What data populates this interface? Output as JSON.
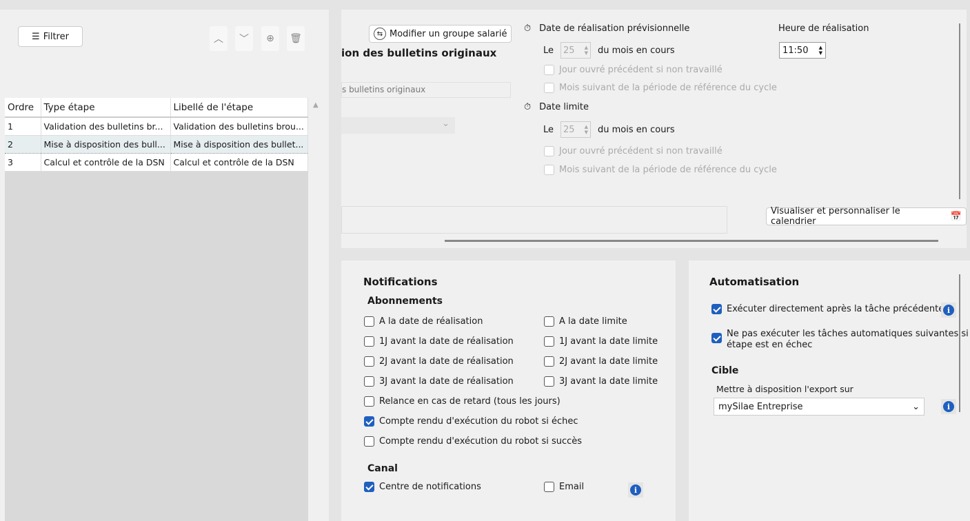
{
  "left": {
    "filter_label": "Filtrer",
    "columns": [
      "Ordre",
      "Type étape",
      "Libellé de l'étape"
    ],
    "rows": [
      {
        "ordre": "1",
        "type": "Validation des bulletins br...",
        "libelle": "Validation des bulletins brou..."
      },
      {
        "ordre": "2",
        "type": "Mise à disposition des bull...",
        "libelle": "Mise à disposition des bullet..."
      },
      {
        "ordre": "3",
        "type": "Calcul et contrôle de la DSN",
        "libelle": "Calcul et contrôle de la DSN"
      }
    ]
  },
  "step": {
    "modify_group_label": "Modifier un groupe salarié",
    "title": "ion des bulletins originaux",
    "name_value": "s bulletins originaux"
  },
  "schedule": {
    "planned_label": "Date de réalisation prévisionnelle",
    "le": "Le",
    "planned_day": "25",
    "month_label": "du mois en cours",
    "prev_workday": "Jour ouvré précédent si non travaillé",
    "next_month": "Mois suivant de la période de référence du cycle",
    "deadline_label": "Date limite",
    "deadline_day": "25",
    "time_label": "Heure de réalisation",
    "time_value": "11:50",
    "calendar_button": "Visualiser et personnaliser le calendrier"
  },
  "notifications": {
    "title": "Notifications",
    "subs_title": "Abonnements",
    "left_items": [
      {
        "label": "A la date de réalisation",
        "checked": false
      },
      {
        "label": "1J avant la date de réalisation",
        "checked": false
      },
      {
        "label": "2J avant la date de réalisation",
        "checked": false
      },
      {
        "label": "3J avant la date de réalisation",
        "checked": false
      },
      {
        "label": "Relance en cas de retard (tous les jours)",
        "checked": false
      },
      {
        "label": "Compte rendu d'exécution du robot si échec",
        "checked": true
      },
      {
        "label": "Compte rendu d'exécution du robot si succès",
        "checked": false
      }
    ],
    "right_items": [
      {
        "label": "A la date limite",
        "checked": false
      },
      {
        "label": "1J avant la date limite",
        "checked": false
      },
      {
        "label": "2J avant la date limite",
        "checked": false
      },
      {
        "label": "3J avant la date limite",
        "checked": false
      }
    ],
    "channel_title": "Canal",
    "channel_center": "Centre de notifications",
    "channel_email": "Email"
  },
  "automation": {
    "title": "Automatisation",
    "run_after": "Exécuter directement après la tâche précédente",
    "no_run_line1": "Ne pas exécuter les tâches automatiques suivantes si",
    "no_run_line2": "étape est en échec",
    "target_title": "Cible",
    "export_label": "Mettre à disposition l'export sur",
    "export_value": "mySilae Entreprise"
  }
}
